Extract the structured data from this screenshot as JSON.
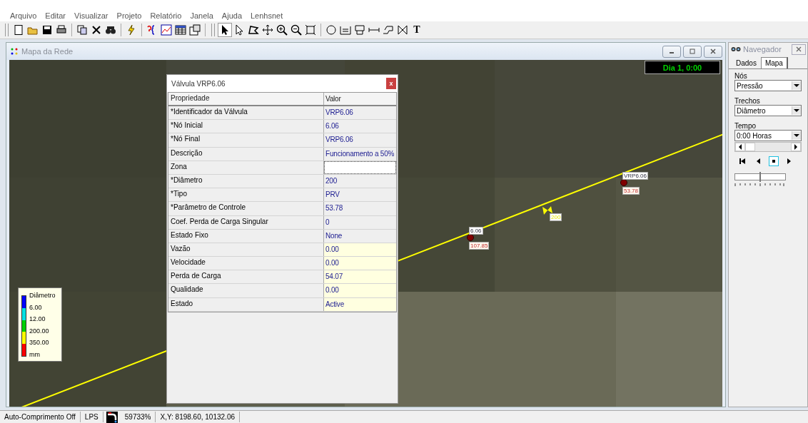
{
  "menu": [
    "Arquivo",
    "Editar",
    "Visualizar",
    "Projeto",
    "Relatório",
    "Janela",
    "Ajuda",
    "Lenhsnet"
  ],
  "toolbar": {
    "text_tool": "T"
  },
  "map_window": {
    "title": "Mapa da Rede",
    "clock": "Dia 1, 0:00",
    "nodes": [
      {
        "id_label": "6.06",
        "value_label": "107.85"
      },
      {
        "id_label": "VRP6.06",
        "value_label": "53.78"
      }
    ],
    "valve_label": "200",
    "legend": {
      "title": "Diâmetro",
      "unit": "mm",
      "bands": [
        {
          "color": "#0000ff"
        },
        {
          "color": "#00e0e0"
        },
        {
          "color": "#00d000"
        },
        {
          "color": "#ffff00"
        },
        {
          "color": "#ff0000"
        }
      ],
      "breaks": [
        "6.00",
        "12.00",
        "200.00",
        "350.00"
      ]
    }
  },
  "dialog": {
    "title": "Válvula VRP6.06",
    "close": "x",
    "columns": [
      "Propriedade",
      "Valor"
    ],
    "rows": [
      {
        "property": "*Identificador da Válvula",
        "value": "VRP6.06",
        "kind": "input",
        "selected": false
      },
      {
        "property": "*Nó Inicial",
        "value": "6.06",
        "kind": "input",
        "selected": false
      },
      {
        "property": "*Nó Final",
        "value": "VRP6.06",
        "kind": "input",
        "selected": false
      },
      {
        "property": "Descrição",
        "value": "Funcionamento a 50%",
        "kind": "input",
        "selected": false
      },
      {
        "property": "Zona",
        "value": "",
        "kind": "input",
        "selected": true
      },
      {
        "property": "*Diâmetro",
        "value": "200",
        "kind": "input",
        "selected": false
      },
      {
        "property": "*Tipo",
        "value": "PRV",
        "kind": "input",
        "selected": false
      },
      {
        "property": "*Parâmetro de Controle",
        "value": "53.78",
        "kind": "input",
        "selected": false
      },
      {
        "property": "Coef. Perda de Carga Singular",
        "value": "0",
        "kind": "input",
        "selected": false
      },
      {
        "property": "Estado Fixo",
        "value": "None",
        "kind": "input",
        "selected": false
      },
      {
        "property": "Vazão",
        "value": "0.00",
        "kind": "output",
        "selected": false
      },
      {
        "property": "Velocidade",
        "value": "0.00",
        "kind": "output",
        "selected": false
      },
      {
        "property": "Perda de Carga",
        "value": "54.07",
        "kind": "output",
        "selected": false
      },
      {
        "property": "Qualidade",
        "value": "0.00",
        "kind": "output",
        "selected": false
      },
      {
        "property": "Estado",
        "value": "Active",
        "kind": "output",
        "selected": false
      }
    ]
  },
  "navigator": {
    "title": "Navegador",
    "tabs": [
      {
        "label": "Dados",
        "selected": false
      },
      {
        "label": "Mapa",
        "selected": true
      }
    ],
    "fields": [
      {
        "label": "Nós",
        "value": "Pressão"
      },
      {
        "label": "Trechos",
        "value": "Diâmetro"
      },
      {
        "label": "Tempo",
        "value": "0:00 Horas"
      }
    ],
    "playback": [
      {
        "kind": "rewind",
        "selected": false
      },
      {
        "kind": "back",
        "selected": false
      },
      {
        "kind": "stop",
        "selected": true
      },
      {
        "kind": "forward",
        "selected": false
      }
    ],
    "speed": {
      "level": 0.5
    }
  },
  "status_bar": {
    "auto_length": "Auto-Comprimento Off",
    "units": "LPS",
    "zoom": "59733%",
    "coords": "X,Y: 8198.60, 10132.06"
  }
}
